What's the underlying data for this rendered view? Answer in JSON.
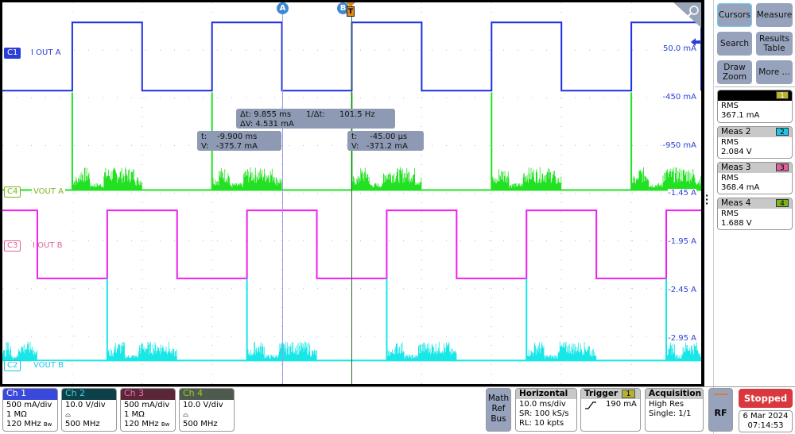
{
  "colors": {
    "ch1": "#1f2fe0",
    "ch2": "#19e6e6",
    "ch3": "#f01ef0",
    "ch4": "#22e022",
    "cursorA": "#9a9ae8",
    "cursorB": "#2a6a2a",
    "readout": "#8e9ab4",
    "stopped": "#d9393e",
    "button": "#97a3bd"
  },
  "cursors": {
    "a_label": "A",
    "b_label": "B",
    "trigger_icon": "T",
    "delta": {
      "dt": "Δt:  9.855 ms",
      "inv_dt": "1/Δt:",
      "freq": "101.5 Hz",
      "dv": "ΔV: 4.531 mA"
    },
    "a": {
      "t": "t:    -9.900 ms",
      "v": "V:   -375.7 mA"
    },
    "b": {
      "t": "t:     -45.00 µs",
      "v": "V:   -371.2 mA"
    }
  },
  "traces": [
    {
      "tag": "C1",
      "label": "I OUT A"
    },
    {
      "tag": "C4",
      "label": "VOUT A"
    },
    {
      "tag": "C3",
      "label": "I OUT B"
    },
    {
      "tag": "C2",
      "label": "VOUT B"
    }
  ],
  "axis_labels": [
    "50.0 mA",
    "-450 mA",
    "-950 mA",
    "-1.45 A",
    "-1.95 A",
    "-2.45 A",
    "-2.95 A"
  ],
  "chart_data": {
    "type": "line",
    "x_unit": "ms",
    "xlim": [
      -50,
      50
    ],
    "x_div": "10.0 ms/div",
    "y_unit": "mA",
    "ylim": [
      -3450,
      550
    ],
    "y_ticks": [
      50,
      -450,
      -950,
      -1450,
      -1950,
      -2450,
      -2950
    ],
    "grid": true,
    "series": [
      {
        "name": "I OUT A",
        "channel": "C1",
        "kind": "square",
        "high": 340,
        "low": -375,
        "rise": [
          -40,
          -20,
          0,
          20,
          40
        ],
        "fall": [
          -30,
          -10,
          10,
          30,
          50
        ],
        "start": "low"
      },
      {
        "name": "VOUT A",
        "channel": "C4",
        "kind": "pulse-noise",
        "base": -1417,
        "top": -393,
        "edges": [
          -40,
          -20,
          0,
          20,
          40
        ],
        "burst_ms": 10,
        "noise_amp": 300
      },
      {
        "name": "I OUT B",
        "channel": "C3",
        "kind": "square",
        "high": -1630,
        "low": -2343,
        "rise": [
          -35,
          -15,
          5,
          25,
          45
        ],
        "fall": [
          -45,
          -25,
          -5,
          15,
          35
        ],
        "start": "high"
      },
      {
        "name": "VOUT B",
        "channel": "C2",
        "kind": "pulse-noise",
        "base": -3204,
        "top": -2343,
        "edges": [
          -35,
          -15,
          5,
          25,
          45
        ],
        "burst_ms": 10,
        "noise_amp": 250,
        "lead_burst": [
          -50,
          -45
        ]
      }
    ],
    "cursor_a_ms": -9.9,
    "cursor_b_ms": 0
  },
  "right_panel": {
    "buttons": [
      "Cursors",
      "Measure",
      "Search",
      "Results Table",
      "Draw Zoom",
      "More ..."
    ],
    "measurements": [
      {
        "title": "",
        "badge": "1",
        "type": "RMS",
        "value": "367.1 mA",
        "color": "#b5b22e"
      },
      {
        "title": "Meas 2",
        "badge": "2",
        "type": "RMS",
        "value": "2.084 V",
        "color": "#19c8e6"
      },
      {
        "title": "Meas 3",
        "badge": "3",
        "type": "RMS",
        "value": "368.4 mA",
        "color": "#e0609a"
      },
      {
        "title": "Meas 4",
        "badge": "4",
        "type": "RMS",
        "value": "1.688 V",
        "color": "#7ab51e"
      }
    ]
  },
  "channels": [
    {
      "name": "Ch 1",
      "scale": "500 mA/div",
      "line2": "1 MΩ",
      "bw": "120 MHz",
      "bw_icon": "Bw",
      "hd": "#3a49dc",
      "fg": "#fff"
    },
    {
      "name": "Ch 2",
      "scale": "10.0 V/div",
      "line2": "probe-icon",
      "bw": "500 MHz",
      "bw_icon": "",
      "hd": "#0d4048",
      "fg": "#3fd0e0"
    },
    {
      "name": "Ch 3",
      "scale": "500 mA/div",
      "line2": "1 MΩ",
      "bw": "120 MHz",
      "bw_icon": "Bw",
      "hd": "#5a2638",
      "fg": "#f070b0"
    },
    {
      "name": "Ch 4",
      "scale": "10.0 V/div",
      "line2": "probe-icon",
      "bw": "500 MHz",
      "bw_icon": "",
      "hd": "#4e5a4e",
      "fg": "#9ad020"
    }
  ],
  "bottom": {
    "math_ref_bus": [
      "Math",
      "Ref",
      "Bus"
    ],
    "horizontal": {
      "title": "Horizontal",
      "scale": "10.0 ms/div",
      "sr": "SR: 100 kS/s",
      "rl": "RL: 10 kpts"
    },
    "trigger": {
      "title": "Trigger",
      "source": "1",
      "level": "190 mA",
      "slope": "rising"
    },
    "acquisition": {
      "title": "Acquisition",
      "mode": "High Res",
      "count": "Single: 1/1"
    },
    "rf": "RF",
    "status": "Stopped",
    "date": "6 Mar 2024",
    "time": "07:14:53"
  }
}
